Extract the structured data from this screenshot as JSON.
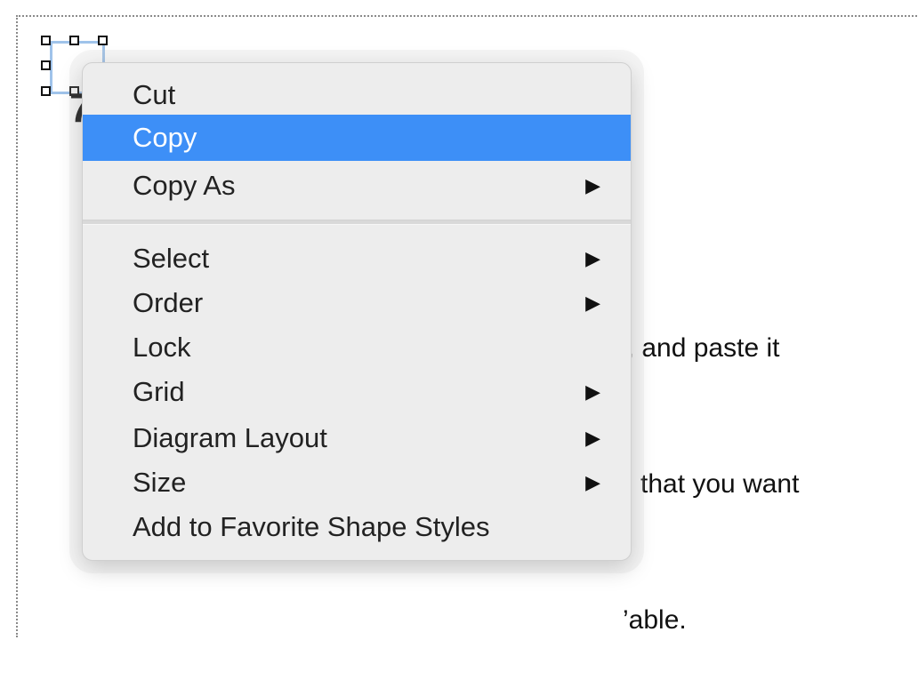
{
  "canvas": {
    "shape_glyph": "7",
    "text_lines": [
      "e, and paste it",
      "that you want",
      "’able."
    ]
  },
  "menu": {
    "items": [
      {
        "label": "Cut",
        "submenu": false,
        "highlighted": false
      },
      {
        "label": "Copy",
        "submenu": false,
        "highlighted": true
      },
      {
        "label": "Copy As",
        "submenu": true,
        "highlighted": false
      },
      {
        "label": "Select",
        "submenu": true,
        "highlighted": false
      },
      {
        "label": "Order",
        "submenu": true,
        "highlighted": false
      },
      {
        "label": "Lock",
        "submenu": false,
        "highlighted": false
      },
      {
        "label": "Grid",
        "submenu": true,
        "highlighted": false
      },
      {
        "label": "Diagram Layout",
        "submenu": true,
        "highlighted": false
      },
      {
        "label": "Size",
        "submenu": true,
        "highlighted": false
      },
      {
        "label": "Add to Favorite Shape Styles",
        "submenu": false,
        "highlighted": false
      }
    ],
    "submenu_arrow_glyph": "▶",
    "highlight_color": "#3d8ff7"
  }
}
